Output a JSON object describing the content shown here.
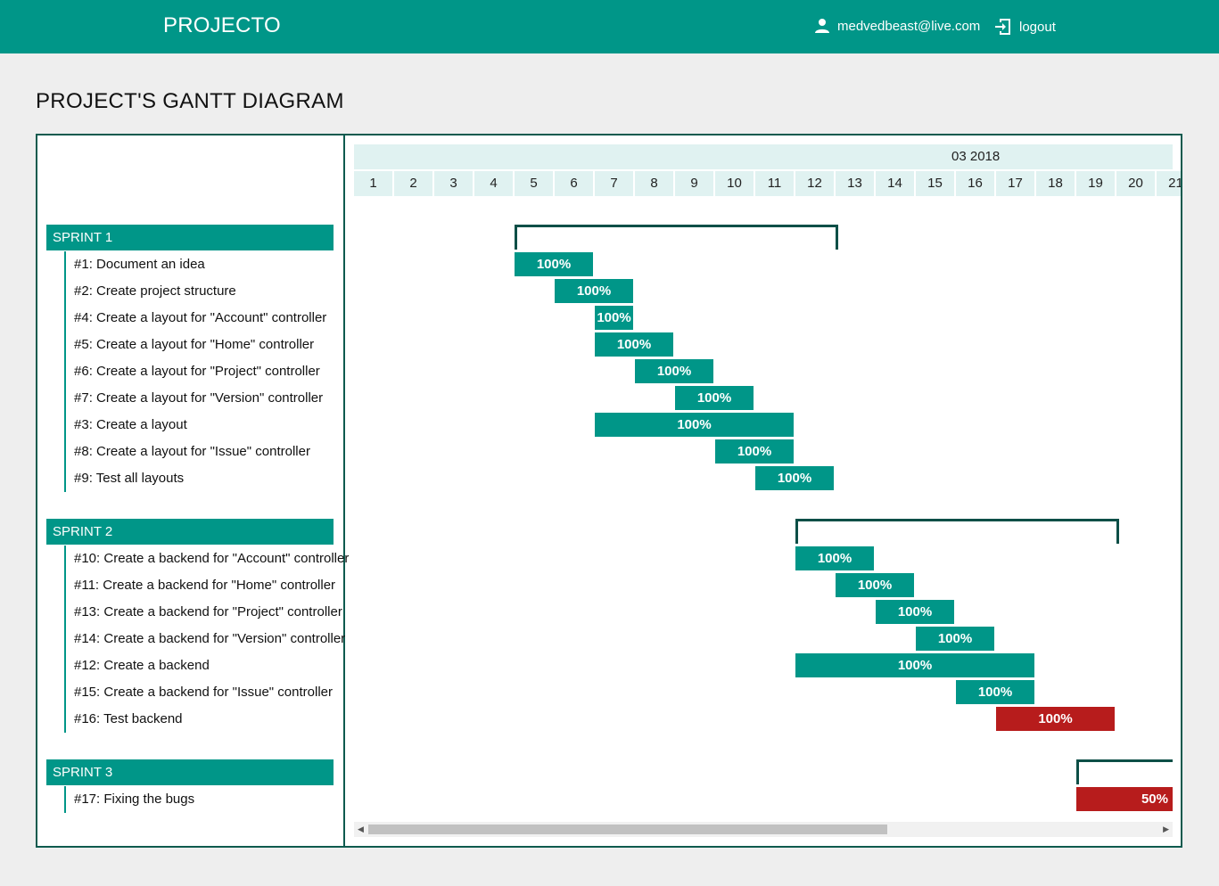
{
  "app": {
    "brand": "PROJECTO",
    "user_email": "medvedbeast@live.com",
    "logout_label": "logout"
  },
  "page": {
    "title": "PROJECT'S GANTT DIAGRAM"
  },
  "timeline": {
    "month": "03 2018",
    "days": [
      "1",
      "2",
      "3",
      "4",
      "5",
      "6",
      "7",
      "8",
      "9",
      "10",
      "11",
      "12",
      "13",
      "14",
      "15",
      "16",
      "17",
      "18",
      "19",
      "20",
      "21"
    ]
  },
  "sprints": [
    {
      "title": "SPRINT 1",
      "start": 5,
      "end": 12,
      "tasks": [
        {
          "id": "#1",
          "name": "Document an idea",
          "start": 5,
          "end": 6,
          "progress": "100%",
          "status": "done"
        },
        {
          "id": "#2",
          "name": "Create project structure",
          "start": 6,
          "end": 7,
          "progress": "100%",
          "status": "done"
        },
        {
          "id": "#4",
          "name": "Create a layout for \"Account\" controller",
          "start": 7,
          "end": 7,
          "progress": "100%",
          "status": "done"
        },
        {
          "id": "#5",
          "name": "Create a layout for \"Home\" controller",
          "start": 7,
          "end": 8,
          "progress": "100%",
          "status": "done"
        },
        {
          "id": "#6",
          "name": "Create a layout for \"Project\" controller",
          "start": 8,
          "end": 9,
          "progress": "100%",
          "status": "done"
        },
        {
          "id": "#7",
          "name": "Create a layout for \"Version\" controller",
          "start": 9,
          "end": 10,
          "progress": "100%",
          "status": "done"
        },
        {
          "id": "#3",
          "name": "Create a layout",
          "start": 7,
          "end": 11,
          "progress": "100%",
          "status": "done"
        },
        {
          "id": "#8",
          "name": "Create a layout for \"Issue\" controller",
          "start": 10,
          "end": 11,
          "progress": "100%",
          "status": "done"
        },
        {
          "id": "#9",
          "name": "Test all layouts",
          "start": 11,
          "end": 12,
          "progress": "100%",
          "status": "done"
        }
      ]
    },
    {
      "title": "SPRINT 2",
      "start": 12,
      "end": 19,
      "tasks": [
        {
          "id": "#10",
          "name": "Create a backend for \"Account\" controller",
          "start": 12,
          "end": 13,
          "progress": "100%",
          "status": "done"
        },
        {
          "id": "#11",
          "name": "Create a backend for \"Home\" controller",
          "start": 13,
          "end": 14,
          "progress": "100%",
          "status": "done"
        },
        {
          "id": "#13",
          "name": "Create a backend for \"Project\" controller",
          "start": 14,
          "end": 15,
          "progress": "100%",
          "status": "done"
        },
        {
          "id": "#14",
          "name": "Create a backend for \"Version\" controller",
          "start": 15,
          "end": 16,
          "progress": "100%",
          "status": "done"
        },
        {
          "id": "#12",
          "name": "Create a backend",
          "start": 12,
          "end": 17,
          "progress": "100%",
          "status": "done"
        },
        {
          "id": "#15",
          "name": "Create a backend for \"Issue\" controller",
          "start": 16,
          "end": 17,
          "progress": "100%",
          "status": "done"
        },
        {
          "id": "#16",
          "name": "Test backend",
          "start": 17,
          "end": 19,
          "progress": "100%",
          "status": "late"
        }
      ]
    },
    {
      "title": "SPRINT 3",
      "start": 19,
      "end": 21,
      "tasks": [
        {
          "id": "#17",
          "name": "Fixing the bugs",
          "start": 19,
          "end": 21,
          "progress": "50%",
          "status": "late"
        }
      ]
    }
  ],
  "colors": {
    "brand": "#009688",
    "done": "#009688",
    "late": "#b71c1c",
    "border": "#0d5a4e",
    "timeline_bg": "#e0f2f1"
  }
}
